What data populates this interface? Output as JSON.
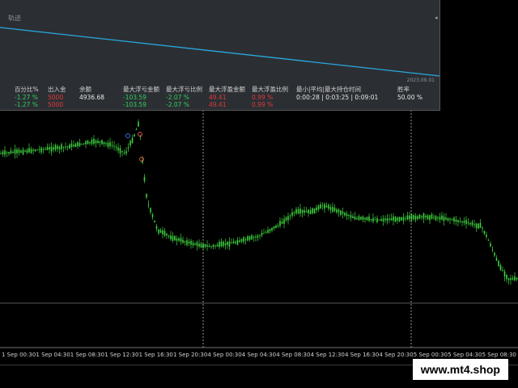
{
  "panel": {
    "title": "轨迹",
    "date_label": "2023.09.01",
    "curve_color": "#29a8e0"
  },
  "stats": {
    "columns": [
      {
        "key": "pct",
        "header": "百分比%",
        "rows": [
          "-1.27 %",
          "-1.27 %"
        ],
        "color": "green"
      },
      {
        "key": "flow",
        "header": "出入金",
        "rows": [
          "5000",
          "5000"
        ],
        "color": "red"
      },
      {
        "key": "balance",
        "header": "余额",
        "rows": [
          "4936.68",
          ""
        ],
        "color": "white"
      },
      {
        "key": "max_float_loss",
        "header": "最大浮亏金额",
        "rows": [
          "-103.59",
          "-103.59"
        ],
        "color": "green"
      },
      {
        "key": "max_float_loss_ratio",
        "header": "最大浮亏比例",
        "rows": [
          "-2.07 %",
          "-2.07 %"
        ],
        "color": "green"
      },
      {
        "key": "max_float_profit",
        "header": "最大浮盈金额",
        "rows": [
          "49.41",
          "49.41"
        ],
        "color": "red"
      },
      {
        "key": "max_float_profit_ratio",
        "header": "最大浮盈比例",
        "rows": [
          "0.99 %",
          "0.99 %"
        ],
        "color": "red"
      },
      {
        "key": "hold_time",
        "header": "最小|平均|最大持仓时间",
        "rows": [
          "0:00:28 | 0:03:25 | 0:09:01",
          ""
        ],
        "color": "white"
      },
      {
        "key": "win_rate",
        "header": "胜率",
        "rows": [
          "50.00 %",
          ""
        ],
        "color": "white"
      }
    ]
  },
  "xaxis": {
    "labels": [
      "1 Sep 00:30",
      "1 Sep 04:30",
      "1 Sep 08:30",
      "1 Sep 12:30",
      "1 Sep 16:30",
      "1 Sep 20:30",
      "4 Sep 00:30",
      "4 Sep 04:30",
      "4 Sep 08:30",
      "4 Sep 12:30",
      "4 Sep 16:30",
      "4 Sep 20:30",
      "5 Sep 00:30",
      "5 Sep 04:30",
      "5 Sep 08:30"
    ]
  },
  "colors": {
    "candle": "#3fd33f",
    "background": "#000000",
    "separator": "#bbbbbb"
  },
  "watermark": "www.mt4.shop"
}
